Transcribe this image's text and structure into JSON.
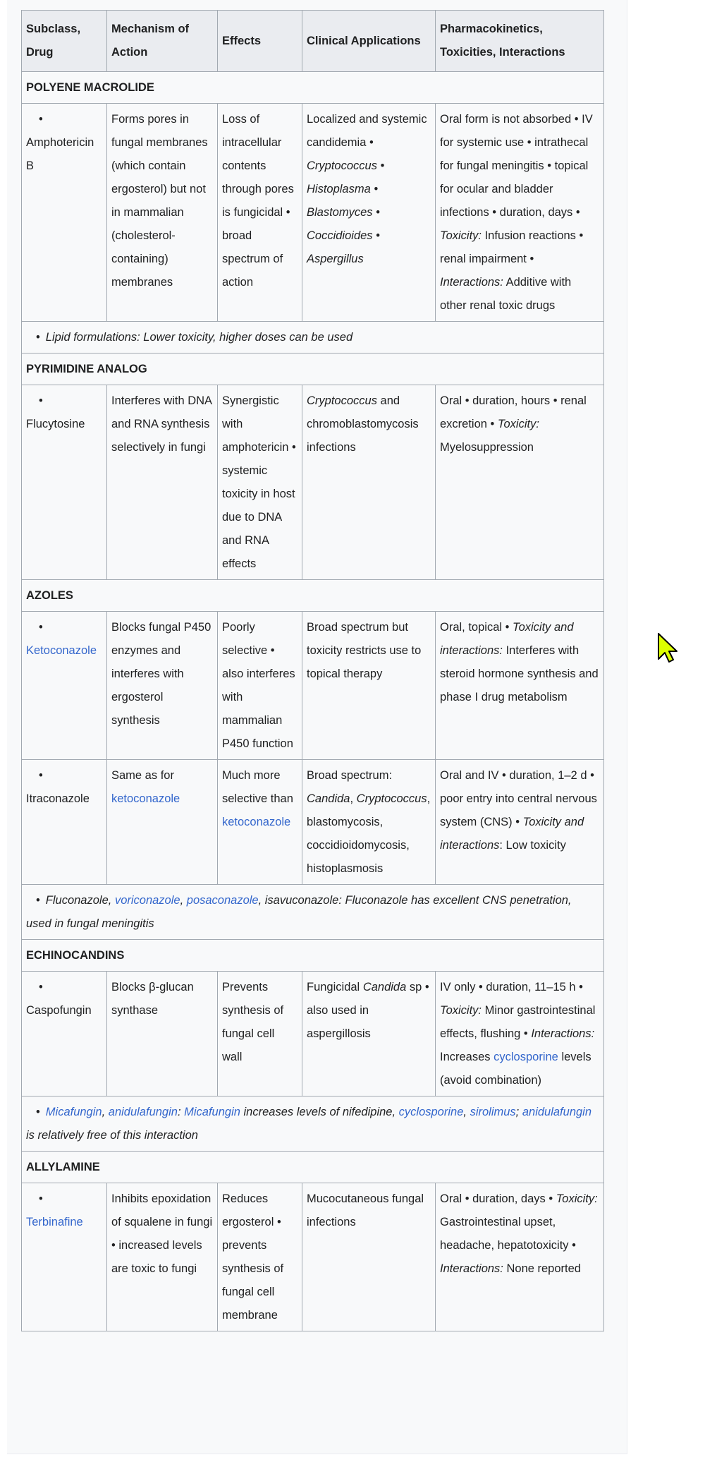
{
  "table": {
    "headers": [
      "Subclass, Drug",
      "Mechanism of Action",
      "Effects",
      "Clinical Applications",
      "Pharmacokinetics, Toxicities, Interactions"
    ],
    "sec_polyene": "POLYENE MACROLIDE",
    "sec_pyrimidine": "PYRIMIDINE ANALOG",
    "sec_azoles": "AZOLES",
    "sec_echino": "ECHINOCANDINS",
    "sec_allyl": "ALLYLAMINE",
    "bullet": "•",
    "ampho": {
      "drug": "Amphotericin B",
      "mech": "Forms pores in fungal membranes (which contain ergosterol) but not in mammalian (cholesterol-containing) membranes",
      "effects": "Loss of intracellular contents through pores is fungicidal • broad spectrum of action",
      "clin_a": "Localized and systemic candidemia •",
      "clin_b": "Cryptococcus • Histoplasma • Blastomyces • Coccidioides • Aspergillus",
      "pk_a": "Oral form is not absorbed • IV for systemic use • intrathecal for fungal meningitis • topical for ocular and bladder infections • duration, days •",
      "pk_tox_label": "Toxicity:",
      "pk_b": "Infusion reactions • renal impairment •",
      "pk_int_label": "Interactions:",
      "pk_c": "Additive with other renal toxic drugs"
    },
    "note_lipid": "Lipid formulations: Lower toxicity, higher doses can be used",
    "flucy": {
      "drug": "Flucytosine",
      "mech": "Interferes with DNA and RNA synthesis selectively in fungi",
      "effects": "Synergistic with amphotericin • systemic toxicity in host due to DNA and RNA effects",
      "clin_a": "Cryptococcus",
      "clin_b": "and chromoblastomycosis infections",
      "pk_a": "Oral • duration, hours • renal excretion •",
      "pk_tox_label": "Toxicity:",
      "pk_b": "Myelosuppression"
    },
    "keto": {
      "drug": "Ketoconazole",
      "mech": "Blocks fungal P450 enzymes and interferes with ergosterol synthesis",
      "effects": "Poorly selective • also interferes with mammalian P450 function",
      "clin": "Broad spectrum but toxicity restricts use to topical therapy",
      "pk_a": "Oral, topical •",
      "pk_label": "Toxicity and interactions:",
      "pk_b": "Interferes with steroid hormone synthesis and phase I drug metabolism"
    },
    "itra": {
      "drug": "Itraconazole",
      "mech_a": "Same as for",
      "mech_link": "ketoconazole",
      "effects_a": "Much more selective than",
      "effects_link": "ketoconazole",
      "clin_a": "Broad spectrum:",
      "clin_candida": "Candida",
      "clin_comma": ",",
      "clin_crypto": "Cryptococcus",
      "clin_b": ", blastomycosis, coccidioidomycosis, histoplasmosis",
      "pk_a": "Oral and IV • duration, 1–2 d • poor entry into central nervous system (CNS) •",
      "pk_label": "Toxicity and interactions",
      "pk_b": ": Low toxicity"
    },
    "note_azoles": {
      "a": "Fluconazole,",
      "vori": "voriconazole",
      "comma": ",",
      "posa": "posaconazole",
      "b": ", isavuconazole: Fluconazole has excellent CNS penetration, used in fungal meningitis"
    },
    "caspo": {
      "drug": "Caspofungin",
      "mech": "Blocks β-glucan synthase",
      "effects": "Prevents synthesis of fungal cell wall",
      "clin_a": "Fungicidal",
      "clin_candida": "Candida",
      "clin_b": "sp • also used in aspergillosis",
      "pk_a": "IV only • duration, 11–15 h •",
      "pk_tox_label": "Toxicity:",
      "pk_b": "Minor gastrointestinal effects, flushing •",
      "pk_int_label": "Interactions:",
      "pk_c": "Increases",
      "pk_link": "cyclosporine",
      "pk_d": "levels (avoid combination)"
    },
    "note_echino": {
      "mica": "Micafungin",
      "comma": ",",
      "anidula": "anidulafungin",
      "colon": ":",
      "mica2": "Micafungin",
      "a": "increases levels of nifedipine,",
      "cyclo": "cyclosporine",
      "b": ",",
      "siro": "sirolimus",
      "semi": ";",
      "anidula2": "anidulafungin",
      "c": "is relatively free of this interaction"
    },
    "terb": {
      "drug": "Terbinafine",
      "mech": "Inhibits epoxidation of squalene in fungi • increased levels are toxic to fungi",
      "effects": "Reduces ergosterol • prevents synthesis of fungal cell membrane",
      "clin": "Mucocutaneous fungal infections",
      "pk_a": "Oral • duration, days •",
      "pk_tox_label": "Toxicity:",
      "pk_b": "Gastrointestinal upset, headache, hepatotoxicity •",
      "pk_int_label": "Interactions:",
      "pk_c": "None reported"
    }
  },
  "colors": {
    "link": "#3366cc",
    "border": "#a2a9b1",
    "cursor": "#ddff00"
  },
  "cursor": {
    "icon": "mouse-pointer-icon"
  }
}
